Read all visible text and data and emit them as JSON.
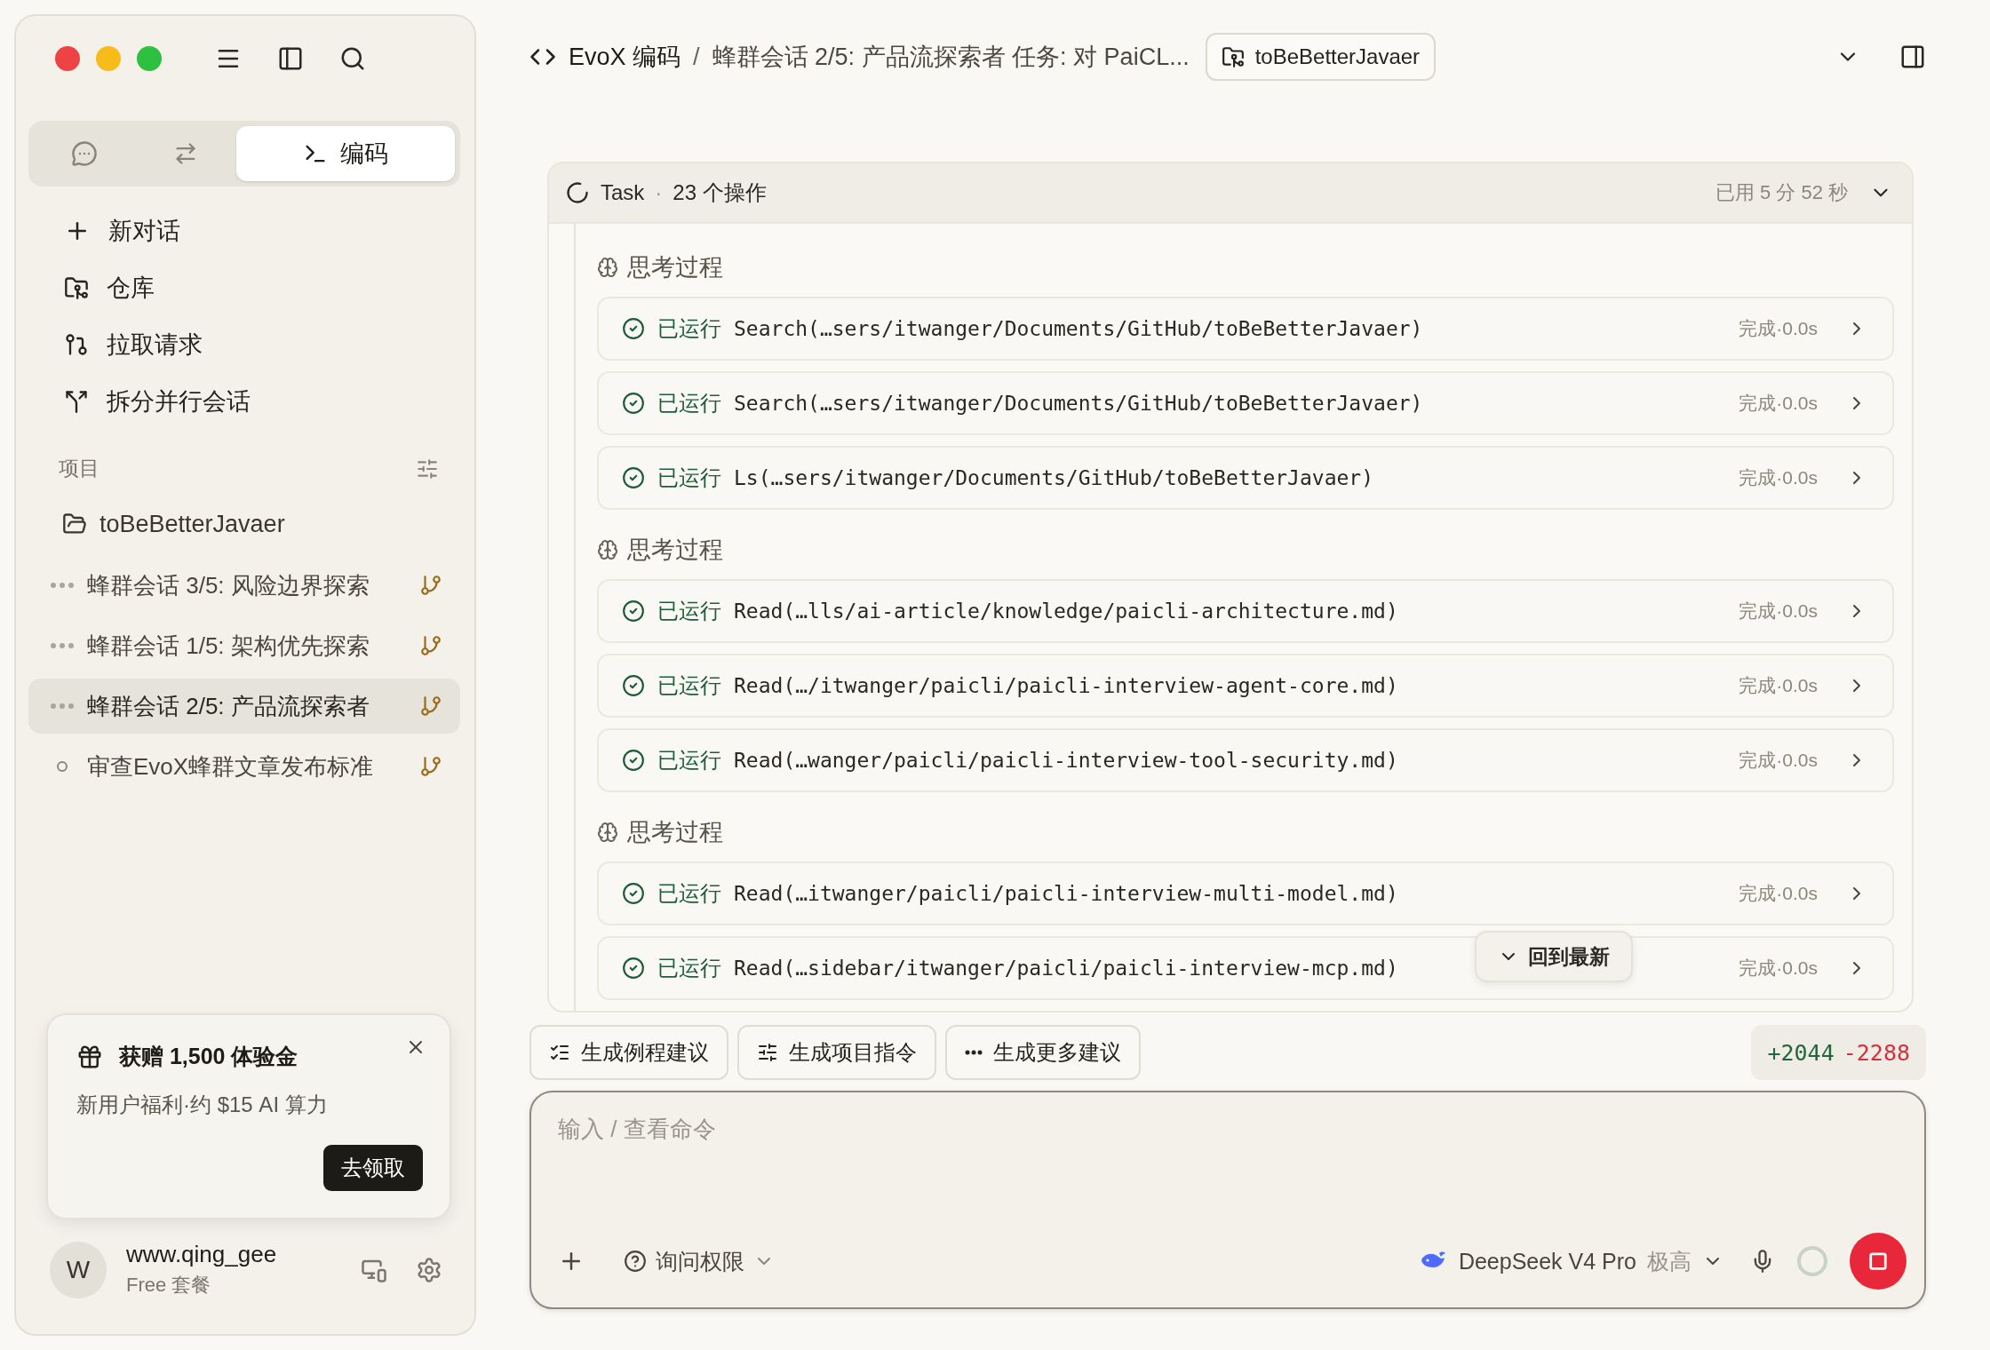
{
  "sidebar": {
    "mode_tabs": [
      {
        "kind": "chat",
        "selected": false
      },
      {
        "kind": "flow",
        "selected": false
      },
      {
        "kind": "code",
        "label": "编码",
        "selected": true
      }
    ],
    "nav": [
      {
        "kind": "new",
        "label": "新对话"
      },
      {
        "kind": "repo",
        "label": "仓库"
      },
      {
        "kind": "pr",
        "label": "拉取请求"
      },
      {
        "kind": "split",
        "label": "拆分并行会话"
      }
    ],
    "projects_heading": "项目",
    "project": {
      "name": "toBeBetterJavaer",
      "sessions": [
        {
          "title": "蜂群会话 3/5: 风险边界探索",
          "kind": "running",
          "selected": false
        },
        {
          "title": "蜂群会话 1/5: 架构优先探索",
          "kind": "running",
          "selected": false
        },
        {
          "title": "蜂群会话 2/5: 产品流探索者",
          "kind": "running",
          "selected": true
        },
        {
          "title": "审查EvoX蜂群文章发布标准",
          "kind": "idle",
          "selected": false
        }
      ]
    },
    "promo": {
      "title": "获赠 1,500 体验金",
      "text": "新用户福利·约 $15 AI 算力",
      "button": "去领取"
    },
    "user": {
      "avatar": "W",
      "name": "www.qing_gee",
      "plan": "Free 套餐"
    }
  },
  "header": {
    "breadcrumb": [
      "EvoX 编码",
      "蜂群会话 2/5: 产品流探索者 任务: 对 PaiCL..."
    ],
    "separator": "/",
    "repo": "toBeBetterJavaer"
  },
  "task": {
    "title": "Task",
    "separator": "·",
    "count": "23 个操作",
    "elapsed": "已用 5 分 52 秒",
    "expanded": true,
    "groups": [
      {
        "label": "思考过程",
        "steps": [
          {
            "status": "已运行",
            "command": "Search(…sers/itwanger/Documents/GitHub/toBeBetterJavaer)",
            "result": "完成·0.0s"
          },
          {
            "status": "已运行",
            "command": "Search(…sers/itwanger/Documents/GitHub/toBeBetterJavaer)",
            "result": "完成·0.0s"
          },
          {
            "status": "已运行",
            "command": "Ls(…sers/itwanger/Documents/GitHub/toBeBetterJavaer)",
            "result": "完成·0.0s"
          }
        ]
      },
      {
        "label": "思考过程",
        "steps": [
          {
            "status": "已运行",
            "command": "Read(…lls/ai-article/knowledge/paicli-architecture.md)",
            "result": "完成·0.0s"
          },
          {
            "status": "已运行",
            "command": "Read(…/itwanger/paicli/paicli-interview-agent-core.md)",
            "result": "完成·0.0s"
          },
          {
            "status": "已运行",
            "command": "Read(…wanger/paicli/paicli-interview-tool-security.md)",
            "result": "完成·0.0s"
          }
        ]
      },
      {
        "label": "思考过程",
        "steps": [
          {
            "status": "已运行",
            "command": "Read(…itwanger/paicli/paicli-interview-multi-model.md)",
            "result": "完成·0.0s"
          },
          {
            "status": "已运行",
            "command": "Read(…sidebar/itwanger/paicli/paicli-interview-mcp.md)",
            "result": "完成·0.0s"
          }
        ]
      }
    ]
  },
  "jump_button": "回到最新",
  "suggestions": [
    {
      "kind": "examples",
      "label": "生成例程建议"
    },
    {
      "kind": "instructions",
      "label": "生成项目指令"
    },
    {
      "kind": "more",
      "label": "生成更多建议"
    }
  ],
  "diff": {
    "added": "+2044",
    "removed": "-2288"
  },
  "composer": {
    "placeholder": "输入 / 查看命令",
    "permission": "询问权限",
    "model": "DeepSeek V4 Pro",
    "effort": "极高"
  }
}
